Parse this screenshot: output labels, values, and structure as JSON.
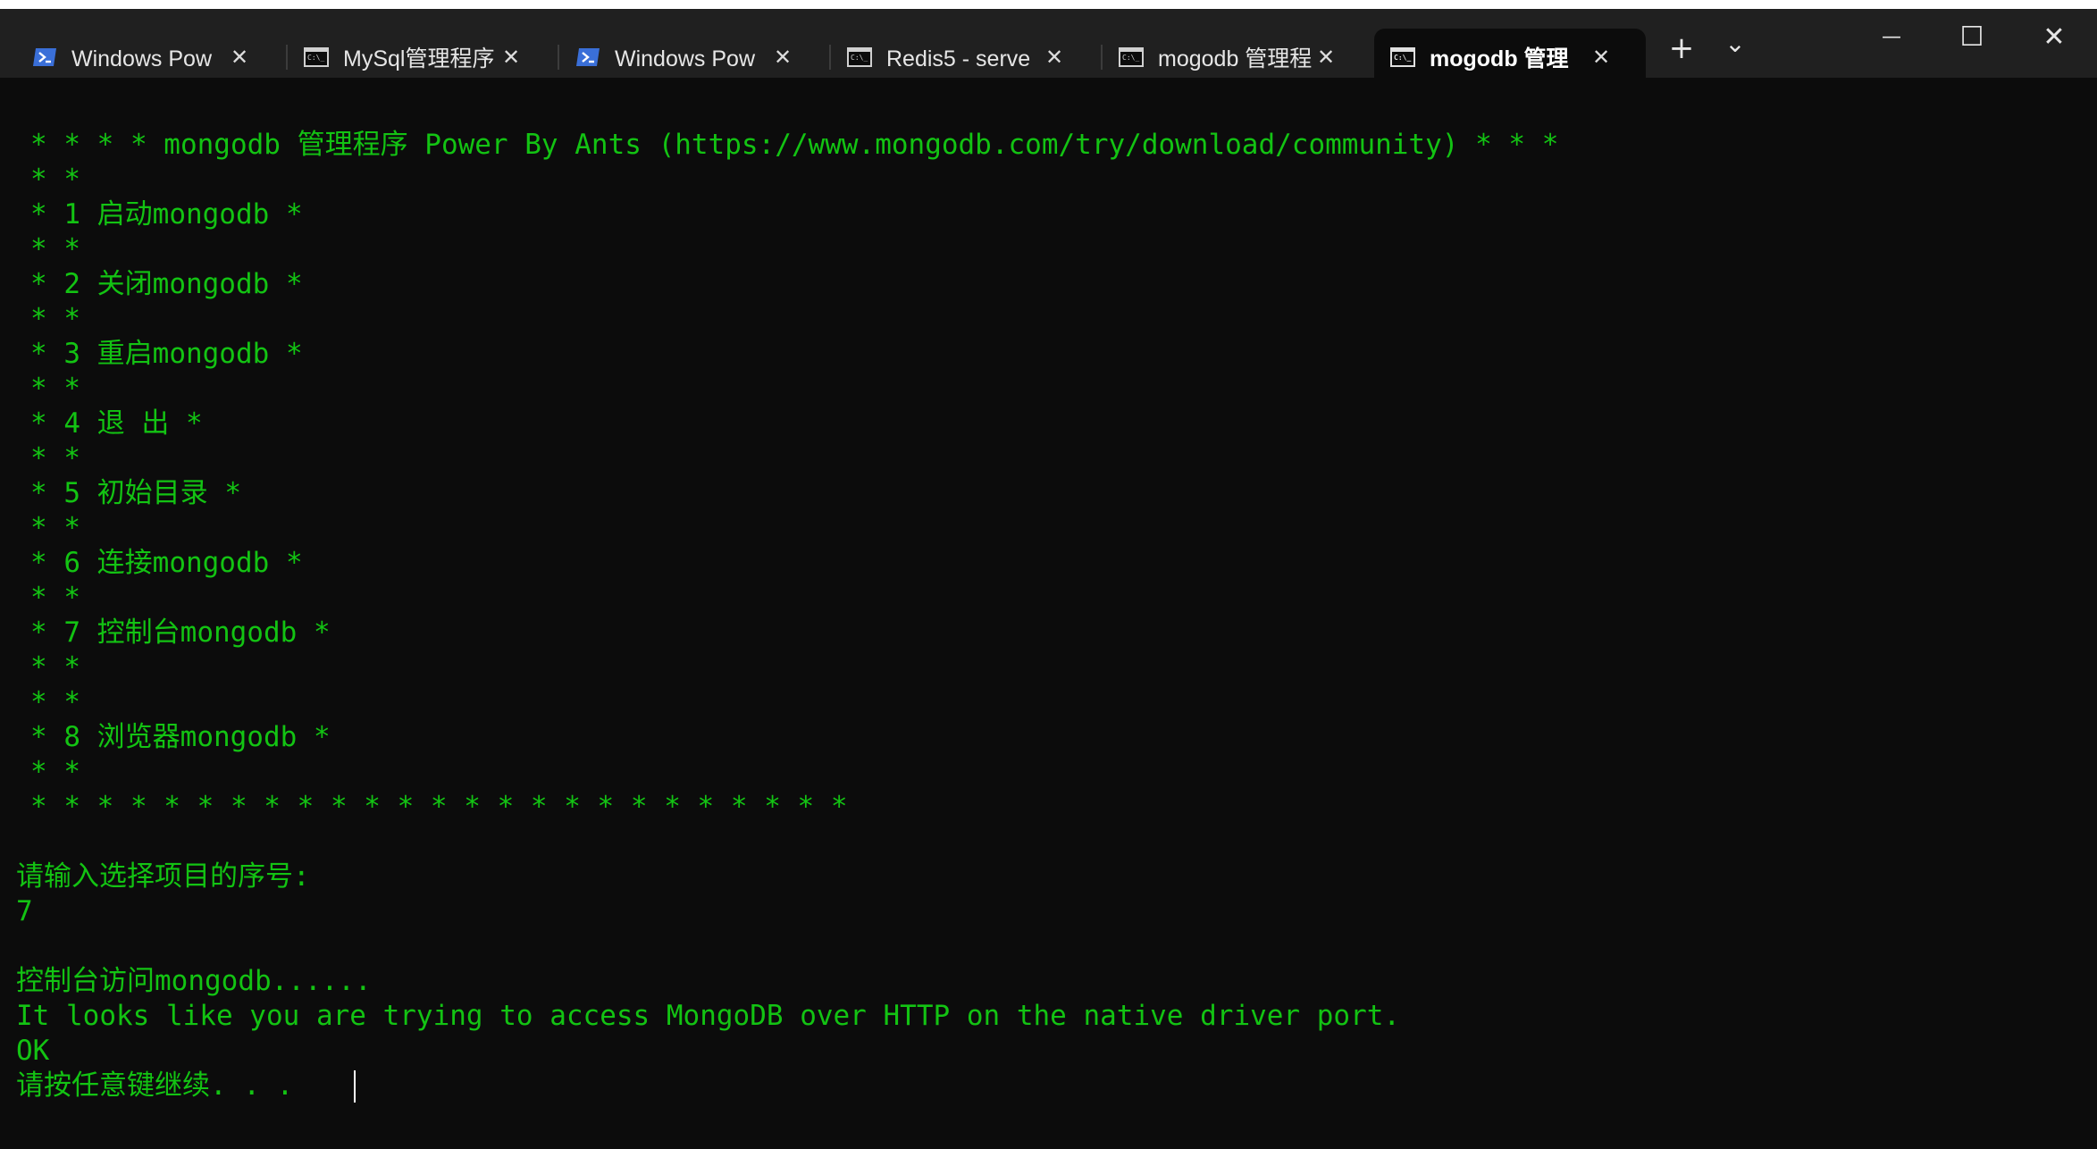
{
  "tabs": [
    {
      "title": "Windows Pow",
      "icon": "powershell-icon",
      "active": false
    },
    {
      "title": "MySql管理程序",
      "icon": "console-icon",
      "active": false
    },
    {
      "title": "Windows Pow",
      "icon": "powershell-icon",
      "active": false
    },
    {
      "title": "Redis5 - serve",
      "icon": "console-icon",
      "active": false
    },
    {
      "title": "mogodb 管理程",
      "icon": "console-icon",
      "active": false
    },
    {
      "title": "mogodb 管理",
      "icon": "console-icon",
      "active": true
    }
  ],
  "tab_close_glyph": "✕",
  "titlebar_buttons": {
    "new_tab": "+",
    "dropdown": "⌄",
    "minimize": "—",
    "maximize": "☐",
    "close": "✕"
  },
  "terminal": {
    "menu_lines": [
      "* * * * mongodb 管理程序 Power By Ants (https://www.mongodb.com/try/download/community) * * *",
      "* *",
      "* 1 启动mongodb *",
      "* *",
      "* 2 关闭mongodb *",
      "* *",
      "* 3 重启mongodb *",
      "* *",
      "* 4 退 出 *",
      "* *",
      "* 5 初始目录 *",
      "* *",
      "* 6 连接mongodb *",
      "* *",
      "* 7 控制台mongodb *",
      "* *",
      "* *",
      "* 8 浏览器mongodb *",
      "* *",
      "* * * * * * * * * * * * * * * * * * * * * * * * *"
    ],
    "output_lines": [
      "请输入选择项目的序号:",
      "7",
      "",
      "控制台访问mongodb......",
      "It looks like you are trying to access MongoDB over HTTP on the native driver port.",
      "OK",
      "请按任意键继续. . ."
    ]
  },
  "colors": {
    "terminal_text": "#13c313",
    "terminal_bg": "#0c0c0c",
    "titlebar_bg": "#202020",
    "powershell_icon": "#3a6fd8"
  }
}
